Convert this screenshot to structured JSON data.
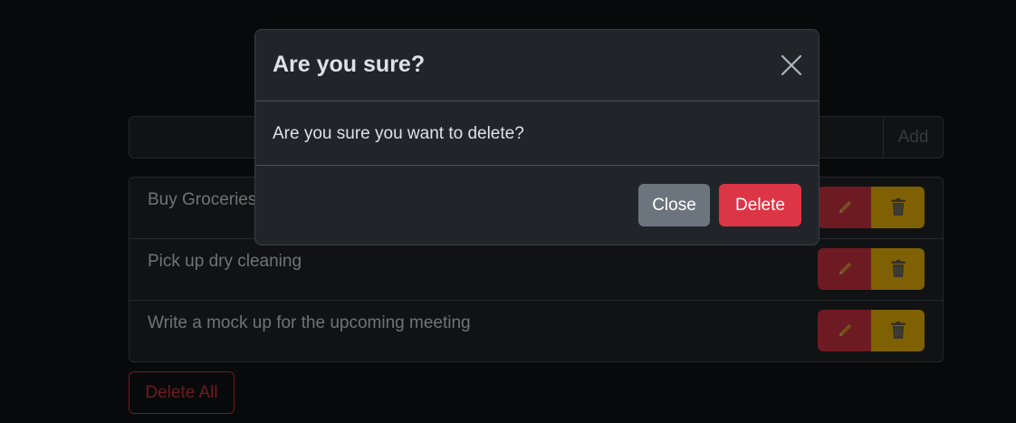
{
  "todo": {
    "input_value": "",
    "input_placeholder": "",
    "add_label": "Add",
    "items": [
      {
        "text": "Buy Groceries"
      },
      {
        "text": "Pick up dry cleaning"
      },
      {
        "text": "Write a mock up for the upcoming meeting"
      }
    ],
    "delete_all_label": "Delete All"
  },
  "modal": {
    "title": "Are you sure?",
    "body": "Are you sure you want to delete?",
    "close_label": "Close",
    "delete_label": "Delete"
  },
  "icons": {
    "edit": "pencil-icon",
    "trash": "trash-icon",
    "close": "close-icon"
  },
  "colors": {
    "danger": "#dc3545",
    "warning": "#ffc107",
    "secondary": "#6c757d",
    "surface": "#212529",
    "background": "#111214"
  }
}
